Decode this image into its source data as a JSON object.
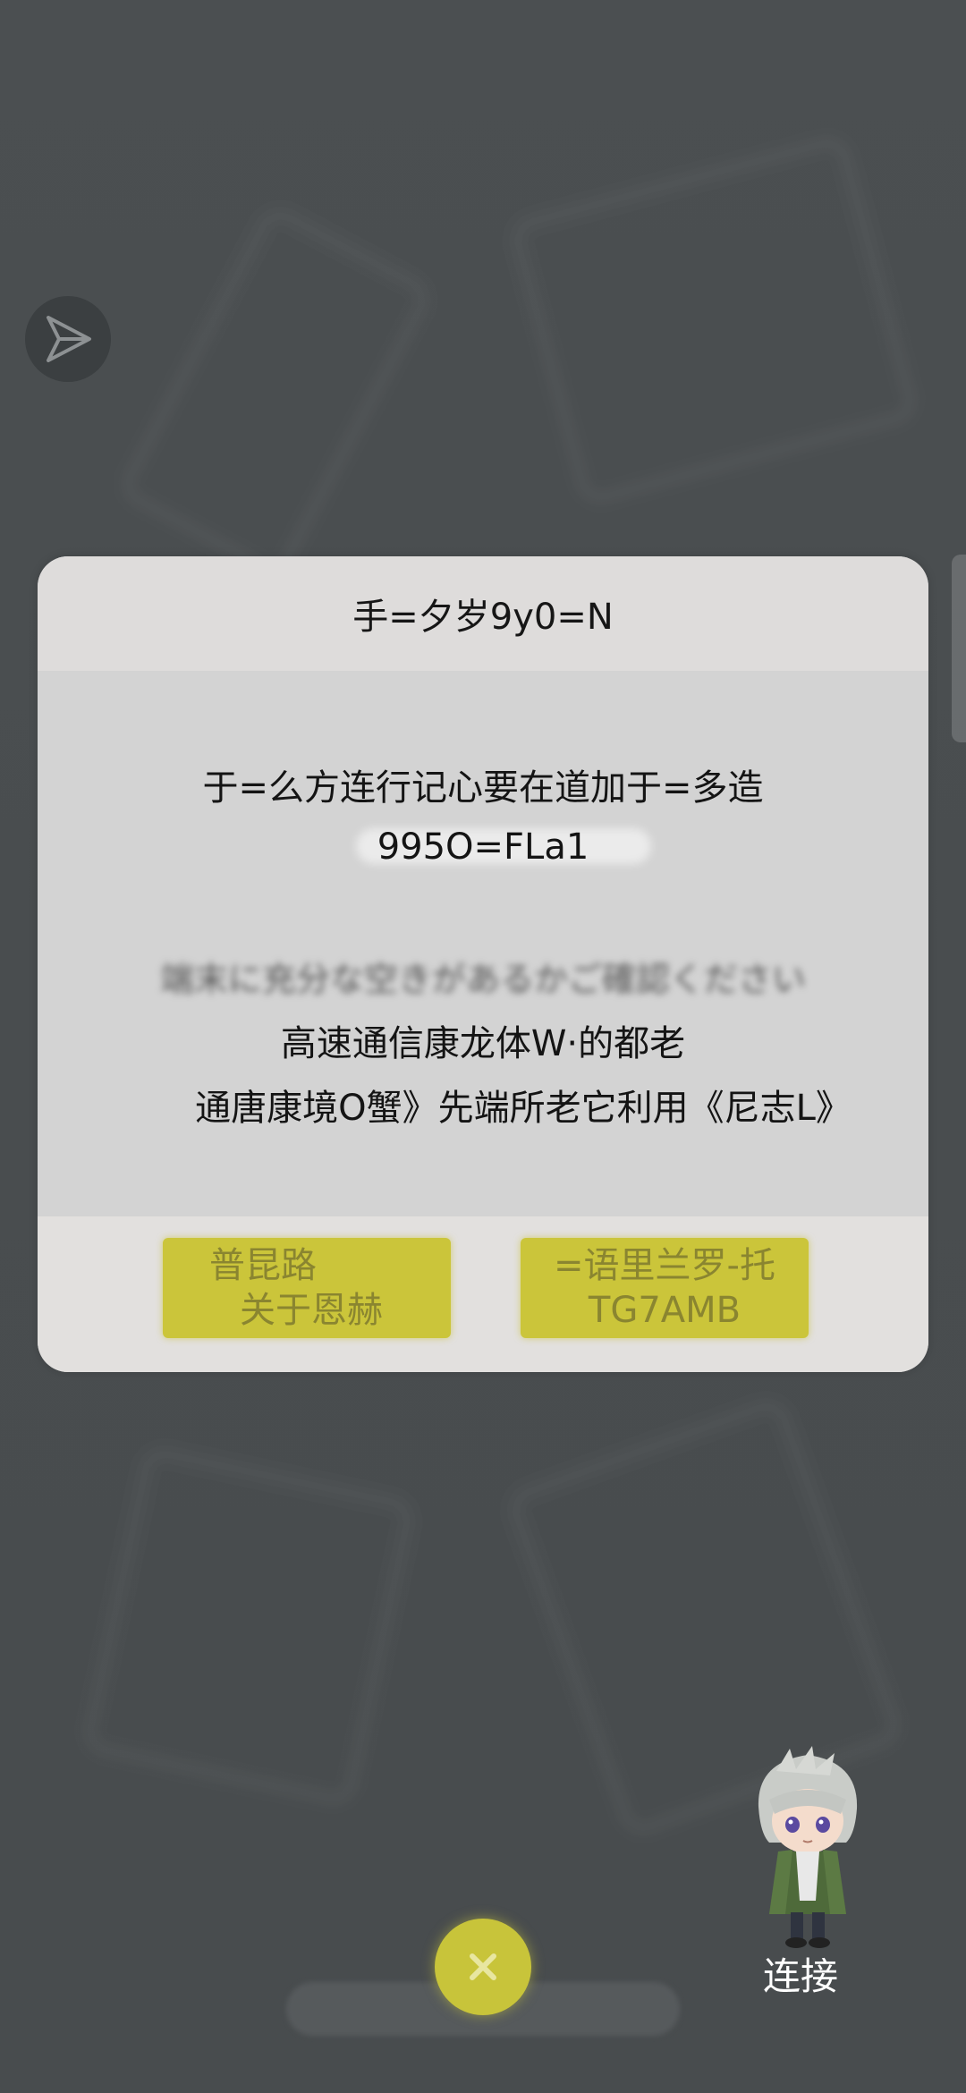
{
  "dialog": {
    "title": "手=夕岁9y0=N",
    "message_line1": "于=么方连行记心要在道加于=多造",
    "message_line2": "995O=FLa1",
    "blurred_hint": "端末に充分な空きがあるかご確認ください",
    "message_line3": "高速通信康龙体W·的都老",
    "message_line4": "通唐康境O蟹》先端所老它利用《尼志L》",
    "buttons": {
      "left": {
        "line1": "普昆路",
        "line2": "关于恩赫"
      },
      "right": {
        "line1": "=语里兰罗-托",
        "line2": "TG7AMB"
      }
    }
  },
  "floating": {
    "close_icon": "close-icon",
    "share_icon": "send-icon",
    "connect_label": "连接"
  },
  "colors": {
    "overlay_bg": "#4a4e50",
    "dialog_bg": "#d6d6d6",
    "button_yellow": "#cbc53a",
    "button_text": "#8a8530"
  }
}
